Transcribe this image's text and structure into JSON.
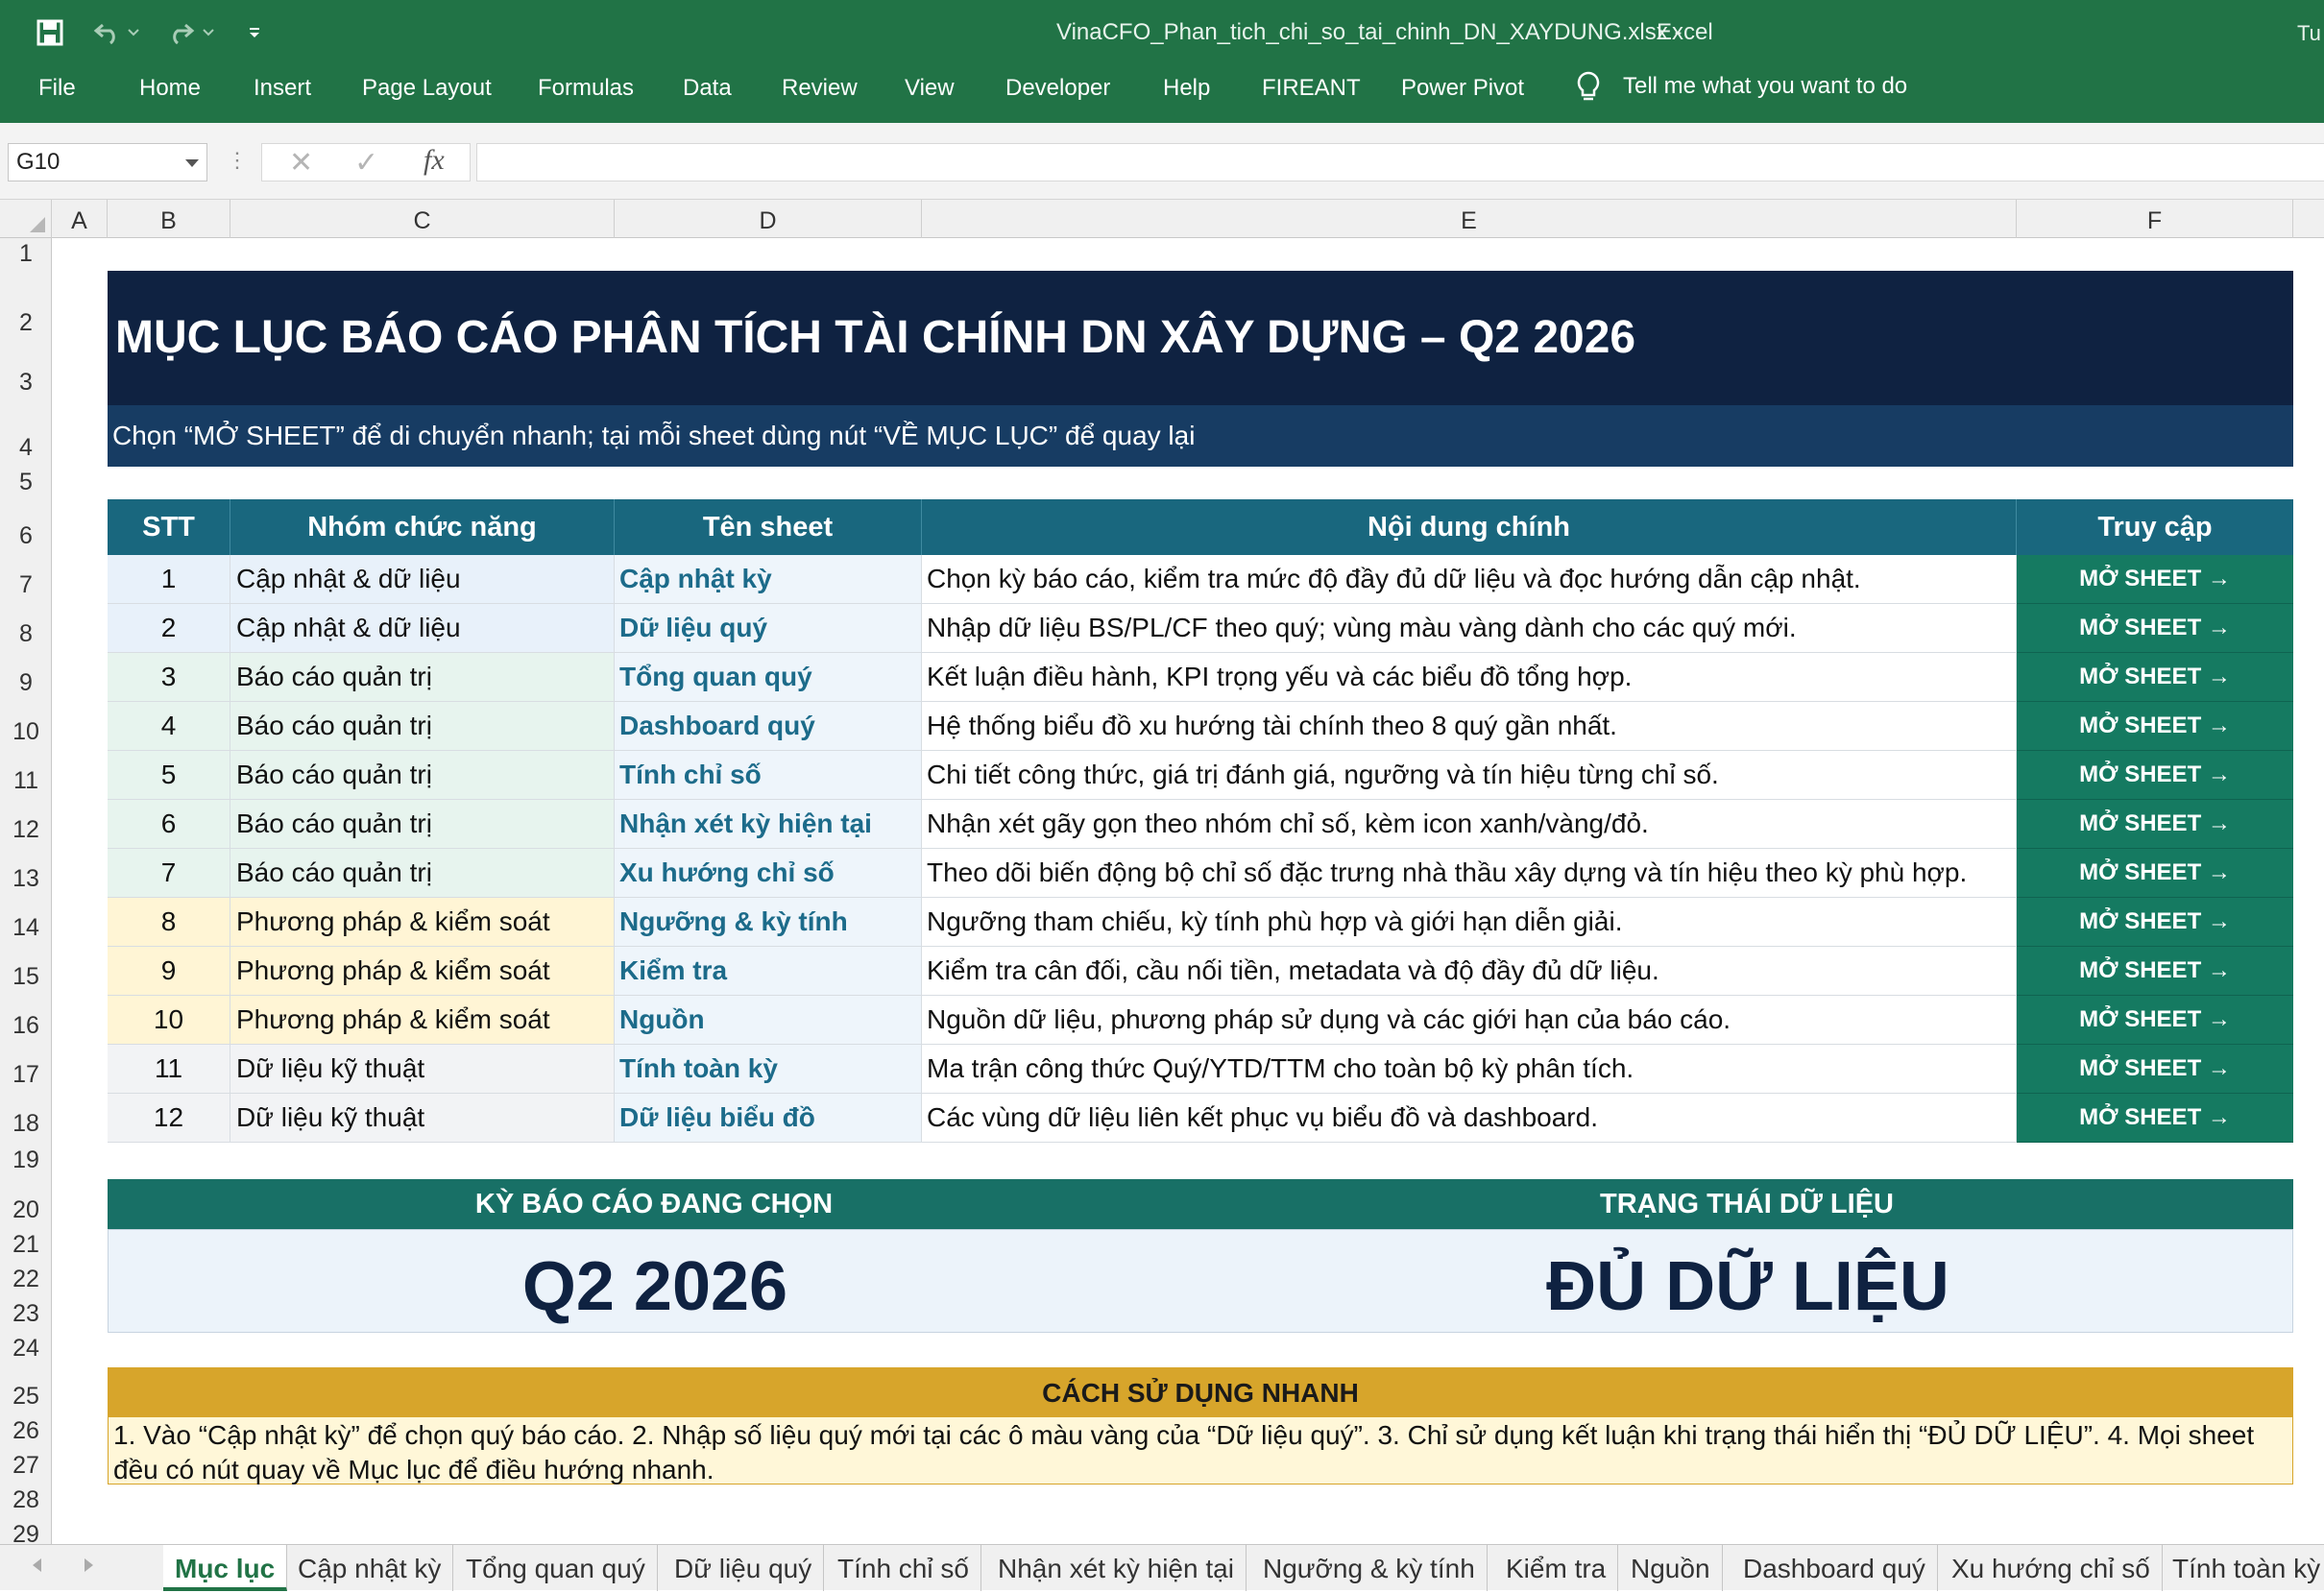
{
  "window": {
    "title": "VinaCFO_Phan_tich_chi_so_tai_chinh_DN_XAYDUNG.xlsx",
    "separator": "-",
    "app": "Excel",
    "user": "Tu"
  },
  "ribbon": {
    "tabs": [
      "File",
      "Home",
      "Insert",
      "Page Layout",
      "Formulas",
      "Data",
      "Review",
      "View",
      "Developer",
      "Help",
      "FIREANT",
      "Power Pivot"
    ],
    "tell_me": "Tell me what you want to do"
  },
  "formula_bar": {
    "cell_ref": "G10",
    "value": ""
  },
  "columns": [
    "A",
    "B",
    "C",
    "D",
    "E",
    "F"
  ],
  "rows": [
    "1",
    "2",
    "3",
    "4",
    "5",
    "6",
    "7",
    "8",
    "9",
    "10",
    "11",
    "12",
    "13",
    "14",
    "15",
    "16",
    "17",
    "18",
    "19",
    "20",
    "21",
    "22",
    "23",
    "24",
    "25",
    "26",
    "27",
    "28",
    "29"
  ],
  "sheet": {
    "title": "MỤC LỤC BÁO CÁO PHÂN TÍCH TÀI CHÍNH DN XÂY DỰNG – Q2 2026",
    "subtitle": "Chọn “MỞ SHEET” để di chuyển nhanh; tại mỗi sheet dùng nút “VỀ MỤC LỤC” để quay lại",
    "toc_headers": [
      "STT",
      "Nhóm chức năng",
      "Tên sheet",
      "Nội dung chính",
      "Truy cập"
    ],
    "toc_rows": [
      {
        "stt": "1",
        "group": "Cập nhật & dữ liệu",
        "sheet": "Cập nhật kỳ",
        "content": "Chọn kỳ báo cáo, kiểm tra mức độ đầy đủ dữ liệu và đọc hướng dẫn cập nhật.",
        "action": "MỞ SHEET →",
        "tone": "blue"
      },
      {
        "stt": "2",
        "group": "Cập nhật & dữ liệu",
        "sheet": "Dữ liệu quý",
        "content": "Nhập dữ liệu BS/PL/CF theo quý; vùng màu vàng dành cho các quý mới.",
        "action": "MỞ SHEET →",
        "tone": "blue"
      },
      {
        "stt": "3",
        "group": "Báo cáo quản trị",
        "sheet": "Tổng quan quý",
        "content": "Kết luận điều hành, KPI trọng yếu và các biểu đồ tổng hợp.",
        "action": "MỞ SHEET →",
        "tone": "green"
      },
      {
        "stt": "4",
        "group": "Báo cáo quản trị",
        "sheet": "Dashboard quý",
        "content": "Hệ thống biểu đồ xu hướng tài chính theo 8 quý gần nhất.",
        "action": "MỞ SHEET →",
        "tone": "green"
      },
      {
        "stt": "5",
        "group": "Báo cáo quản trị",
        "sheet": "Tính chỉ số",
        "content": "Chi tiết công thức, giá trị đánh giá, ngưỡng và tín hiệu từng chỉ số.",
        "action": "MỞ SHEET →",
        "tone": "green"
      },
      {
        "stt": "6",
        "group": "Báo cáo quản trị",
        "sheet": "Nhận xét kỳ hiện tại",
        "content": "Nhận xét gãy gọn theo nhóm chỉ số, kèm icon xanh/vàng/đỏ.",
        "action": "MỞ SHEET →",
        "tone": "green"
      },
      {
        "stt": "7",
        "group": "Báo cáo quản trị",
        "sheet": "Xu hướng chỉ số",
        "content": "Theo dõi biến động bộ chỉ số đặc trưng nhà thầu xây dựng và tín hiệu theo kỳ phù hợp.",
        "action": "MỞ SHEET →",
        "tone": "green"
      },
      {
        "stt": "8",
        "group": "Phương pháp & kiểm soát",
        "sheet": "Ngưỡng & kỳ tính",
        "content": "Ngưỡng tham chiếu, kỳ tính phù hợp và giới hạn diễn giải.",
        "action": "MỞ SHEET →",
        "tone": "yellow"
      },
      {
        "stt": "9",
        "group": "Phương pháp & kiểm soát",
        "sheet": "Kiểm tra",
        "content": "Kiểm tra cân đối, cầu nối tiền, metadata và độ đầy đủ dữ liệu.",
        "action": "MỞ SHEET →",
        "tone": "yellow"
      },
      {
        "stt": "10",
        "group": "Phương pháp & kiểm soát",
        "sheet": "Nguồn",
        "content": "Nguồn dữ liệu, phương pháp sử dụng và các giới hạn của báo cáo.",
        "action": "MỞ SHEET →",
        "tone": "yellow"
      },
      {
        "stt": "11",
        "group": "Dữ liệu kỹ thuật",
        "sheet": "Tính toàn kỳ",
        "content": "Ma trận công thức Quý/YTD/TTM cho toàn bộ kỳ phân tích.",
        "action": "MỞ SHEET →",
        "tone": "gray"
      },
      {
        "stt": "12",
        "group": "Dữ liệu kỹ thuật",
        "sheet": "Dữ liệu biểu đồ",
        "content": "Các vùng dữ liệu liên kết phục vụ biểu đồ và dashboard.",
        "action": "MỞ SHEET →",
        "tone": "gray"
      }
    ],
    "status": {
      "period_label": "KỲ BÁO CÁO ĐANG CHỌN",
      "period_value": "Q2 2026",
      "data_label": "TRẠNG THÁI DỮ LIỆU",
      "data_value": "ĐỦ DỮ LIỆU"
    },
    "guide": {
      "title": "CÁCH SỬ DỤNG NHANH",
      "text": "1. Vào “Cập nhật kỳ” để chọn quý báo cáo.  2. Nhập số liệu quý mới tại các ô màu vàng của “Dữ liệu quý”.  3. Chỉ sử dụng kết luận khi trạng thái hiển thị “ĐỦ DỮ LIỆU”.  4. Mọi sheet đều có nút quay về Mục lục để điều hướng nhanh."
    }
  },
  "sheet_tabs": [
    "Mục lục",
    "Cập nhật kỳ",
    "Tổng quan quý",
    "Dữ liệu quý",
    "Tính chỉ số",
    "Nhận xét kỳ hiện tại",
    "Ngưỡng & kỳ tính",
    "Kiểm tra",
    "Nguồn",
    "Dashboard quý",
    "Xu hướng chỉ số",
    "Tính toàn kỳ"
  ],
  "colors": {
    "excel_green": "#217346",
    "banner": "#0f2241",
    "header_teal": "#19677e",
    "action_green": "#157a61",
    "guide_gold": "#d7a52b"
  }
}
